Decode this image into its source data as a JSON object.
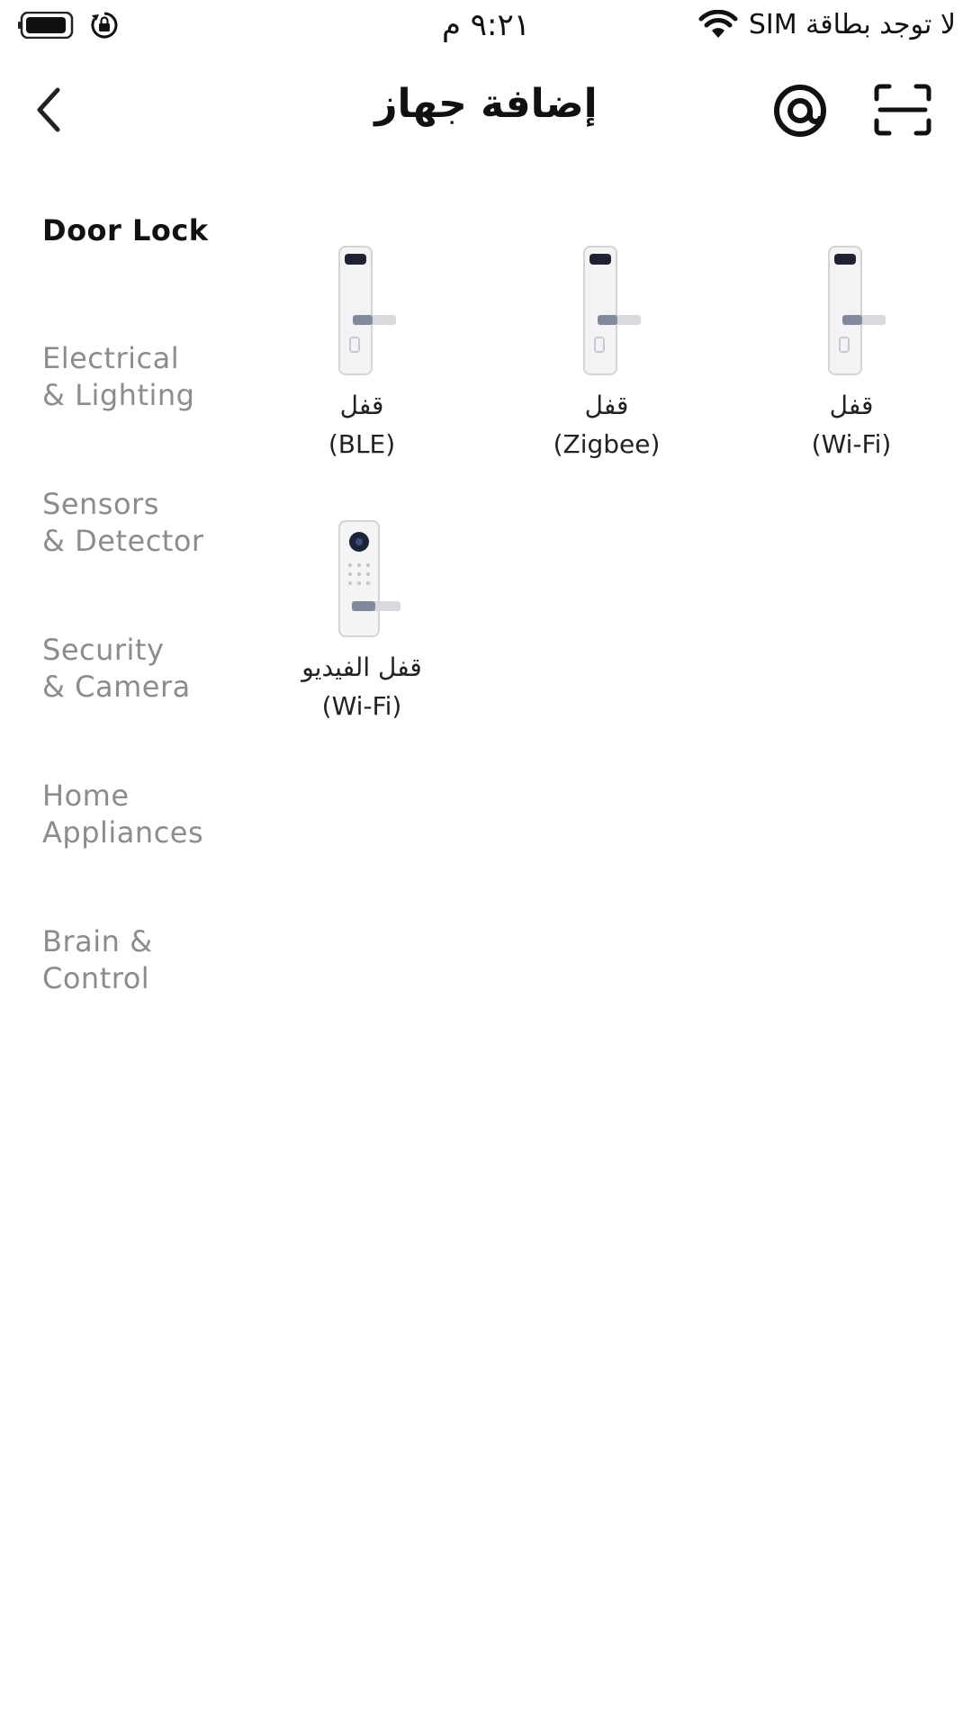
{
  "status_bar": {
    "carrier": "لا توجد بطاقة SIM",
    "time": "٩:٢١ م"
  },
  "nav": {
    "title": "إضافة جهاز"
  },
  "sidebar": {
    "categories": [
      {
        "label": "Door Lock"
      },
      {
        "label": "Electrical\n& Lighting"
      },
      {
        "label": "Sensors\n& Detector"
      },
      {
        "label": "Security\n& Camera"
      },
      {
        "label": "Home\nAppliances"
      },
      {
        "label": "Brain &\nControl"
      }
    ]
  },
  "devices": [
    {
      "name": "قفل",
      "protocol": "(Wi-Fi)",
      "icon": "door-lock-icon"
    },
    {
      "name": "قفل",
      "protocol": "(Zigbee)",
      "icon": "door-lock-icon"
    },
    {
      "name": "قفل",
      "protocol": "(BLE)",
      "icon": "door-lock-icon"
    },
    {
      "name": "قفل الفيديو",
      "protocol": "(Wi-Fi)",
      "icon": "video-lock-icon"
    }
  ],
  "colors": {
    "active_category": "#111111",
    "inactive_category": "#8c8c8c",
    "background": "#ffffff"
  }
}
